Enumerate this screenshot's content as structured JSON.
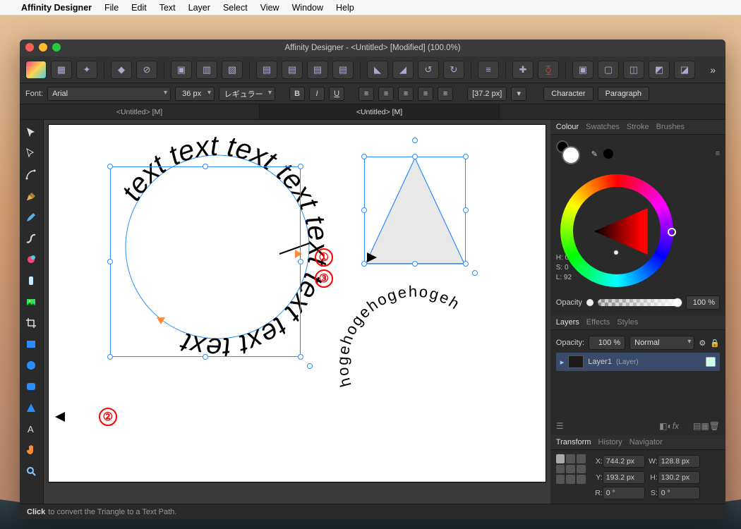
{
  "mac_menu": {
    "app": "Affinity Designer",
    "items": [
      "File",
      "Edit",
      "Text",
      "Layer",
      "Select",
      "View",
      "Window",
      "Help"
    ]
  },
  "window": {
    "title": "Affinity Designer - <Untitled> [Modified] (100.0%)"
  },
  "doc_tabs": [
    "<Untitled> [M]",
    "<Untitled> [M]"
  ],
  "text_toolbar": {
    "font_label": "Font:",
    "font_family": "Arial",
    "font_size": "36 px",
    "font_weight": "レギュラー",
    "leading": "[37.2 px]",
    "char_btn": "Character",
    "para_btn": "Paragraph"
  },
  "panels": {
    "colour_tabs": [
      "Colour",
      "Swatches",
      "Stroke",
      "Brushes"
    ],
    "hsl": {
      "H": "0",
      "S": "0",
      "L": "92"
    },
    "opacity_label": "Opacity",
    "opacity_value": "100 %",
    "layers_tabs": [
      "Layers",
      "Effects",
      "Styles"
    ],
    "layer_opacity_label": "Opacity:",
    "layer_opacity_value": "100 %",
    "blend_mode": "Normal",
    "layer_name": "Layer1",
    "layer_suffix": "(Layer)",
    "transform_tabs": [
      "Transform",
      "History",
      "Navigator"
    ],
    "transform": {
      "X": "744.2 px",
      "Y": "193.2 px",
      "W": "128.8 px",
      "H": "130.2 px",
      "R": "0 °",
      "S": "0 °"
    }
  },
  "statusbar": {
    "hint_strong": "Click",
    "hint_rest": "to convert the Triangle to a Text Path."
  },
  "canvas": {
    "circle_text": "text text text text text text text text",
    "arc_text": "hogehogehogehogeh",
    "annotation_1": "①",
    "annotation_2": "②",
    "annotation_3": "③"
  },
  "tool_names": [
    "move",
    "node",
    "pen",
    "pencil",
    "brush",
    "vector-brush",
    "fill",
    "gradient",
    "crop",
    "rectangle",
    "ellipse",
    "rounded-rect",
    "triangle",
    "artistic-text",
    "pan",
    "zoom"
  ]
}
